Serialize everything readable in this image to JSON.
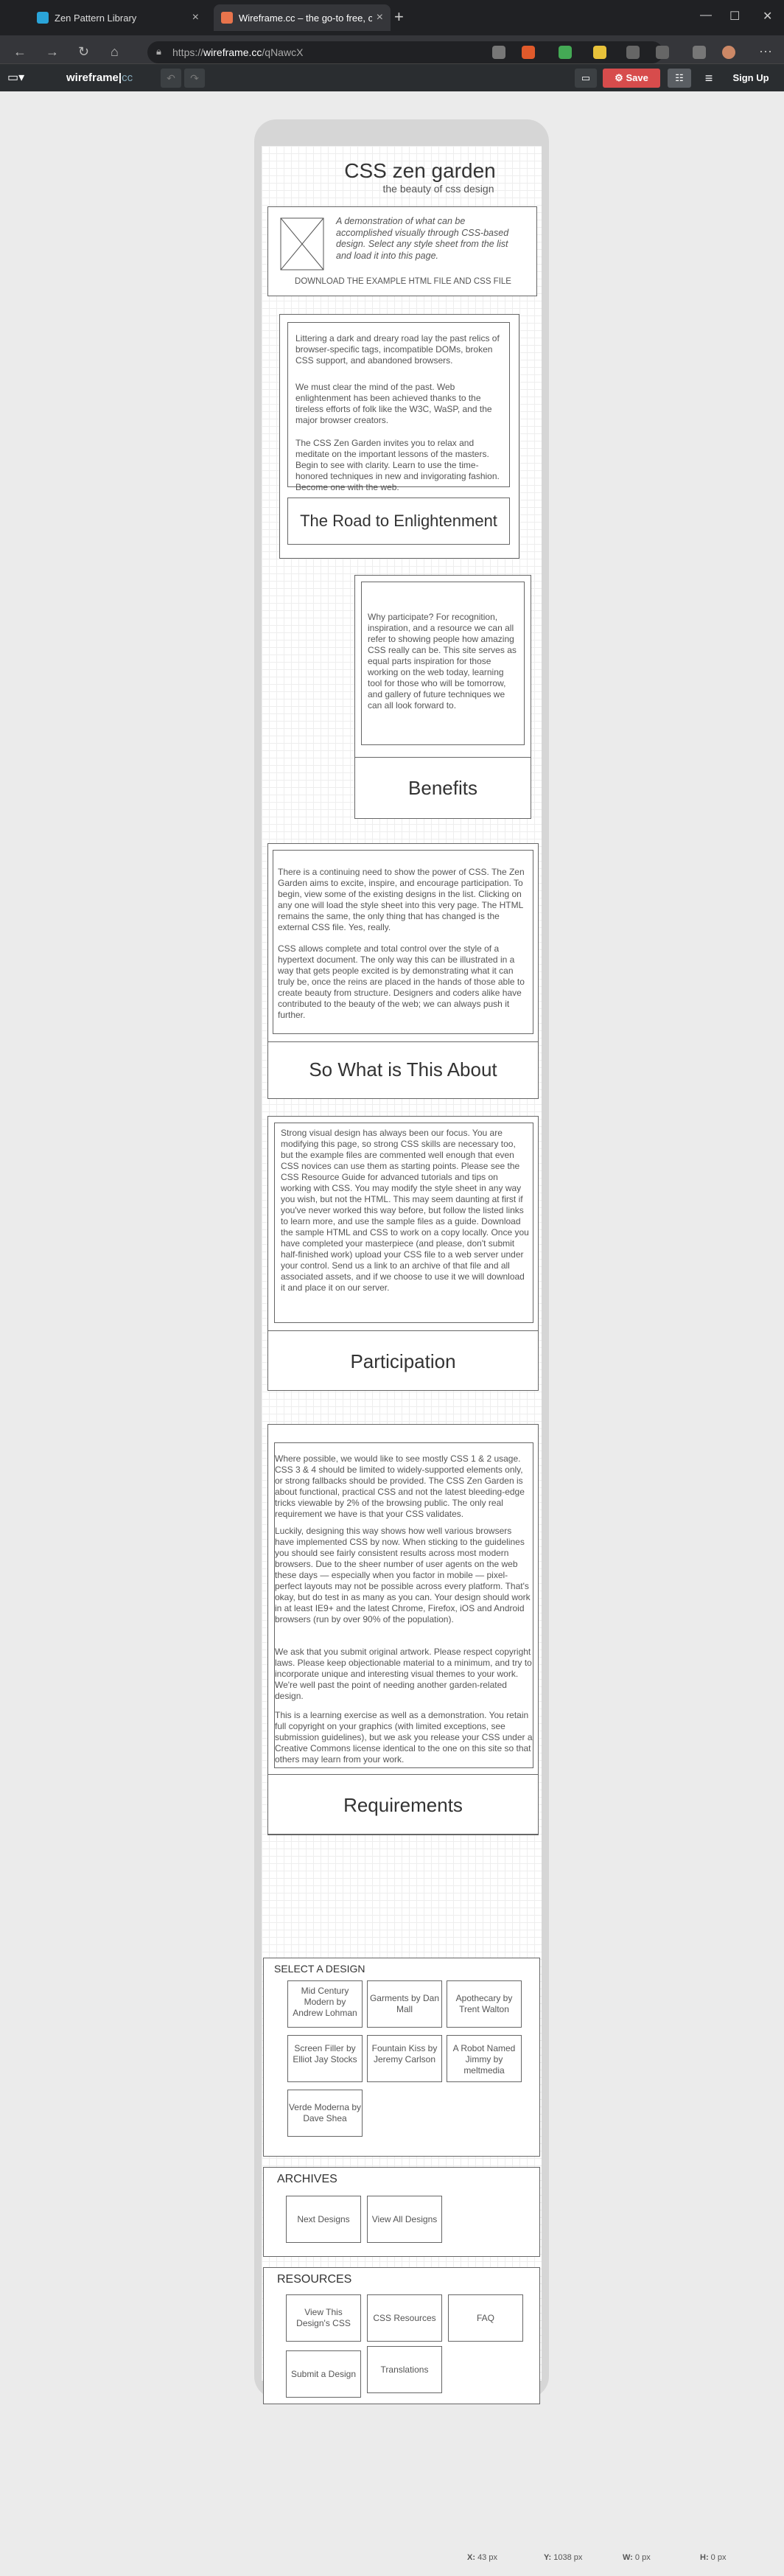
{
  "browser": {
    "tabs": [
      {
        "title": "Zen Pattern Library",
        "color": "#2aa4d9"
      },
      {
        "title": "Wireframe.cc – the go-to free, o",
        "color": "#e8744c"
      }
    ],
    "url_prefix": "https://",
    "url_host": "wireframe.cc",
    "url_path": "/qNawcX"
  },
  "app": {
    "logo_main": "wireframe",
    "logo_suffix": "cc",
    "save_label": "Save",
    "signup_label": "Sign Up"
  },
  "page": {
    "title": "CSS zen garden",
    "subtitle": "the beauty of css design",
    "intro": "A demonstration of what can be accomplished visually through CSS-based design. Select any style sheet from the list and load it into this page.",
    "download": "DOWNLOAD THE EXAMPLE HTML FILE AND CSS FILE",
    "road_text_1": "Littering a dark and dreary road lay the past relics of browser-specific tags, incompatible DOMs, broken CSS support, and abandoned browsers.",
    "road_text_2": "We must clear the mind of the past. Web enlightenment has been achieved thanks to the tireless efforts of folk like the W3C, WaSP, and the major browser creators.",
    "road_text_3": "The CSS Zen Garden invites you to relax and meditate on the important lessons of the masters. Begin to see with clarity. Learn to use the time-honored techniques in new and invigorating fashion. Become one with the web.",
    "road_heading": "The Road to Enlightenment",
    "benefits_text": "Why participate? For recognition, inspiration, and a resource we can all refer to showing people how amazing CSS really can be. This site serves as equal parts inspiration for those working on the web today, learning tool for those who will be tomorrow, and gallery of future techniques we can all look forward to.",
    "benefits_heading": "Benefits",
    "about_text_1": "There is a continuing need to show the power of CSS. The Zen Garden aims to excite, inspire, and encourage participation. To begin, view some of the existing designs in the list. Clicking on any one will load the style sheet into this very page. The HTML remains the same, the only thing that has changed is the external CSS file. Yes, really.",
    "about_text_2": "CSS allows complete and total control over the style of a hypertext document. The only way this can be illustrated in a way that gets people excited is by demonstrating what it can truly be, once the reins are placed in the hands of those able to create beauty from structure. Designers and coders alike have contributed to the beauty of the web; we can always push it further.",
    "about_heading": "So What is This About",
    "part_text": "Strong visual design has always been our focus. You are modifying this page, so strong CSS skills are necessary too, but the example files are commented well enough that even CSS novices can use them as starting points. Please see the CSS Resource Guide for advanced tutorials and tips on working with CSS. You may modify the style sheet in any way you wish, but not the HTML. This may seem daunting at first if you've never worked this way before, but follow the listed links to learn more, and use the sample files as a guide. Download the sample HTML and CSS to work on a copy locally. Once you have completed your masterpiece (and please, don't submit half-finished work) upload your CSS file to a web server under your control. Send us a link to an archive of that file and all associated assets, and if we choose to use it we will download it and place it on our server.",
    "part_heading": "Participation",
    "req_text_1": "Where possible, we would like to see mostly CSS 1 & 2 usage. CSS 3 & 4 should be limited to widely-supported elements only, or strong fallbacks should be provided. The CSS Zen Garden is about functional, practical CSS and not the latest bleeding-edge tricks viewable by 2% of the browsing public. The only real requirement we have is that your CSS validates.",
    "req_text_2": "Luckily, designing this way shows how well various browsers have implemented CSS by now. When sticking to the guidelines you should see fairly consistent results across most modern browsers. Due to the sheer number of user agents on the web these days — especially when you factor in mobile — pixel-perfect layouts may not be possible across every platform. That's okay, but do test in as many as you can. Your design should work in at least IE9+ and the latest Chrome, Firefox, iOS and Android browsers (run by over 90% of the population).",
    "req_text_3": "We ask that you submit original artwork. Please respect copyright laws. Please keep objectionable material to a minimum, and try to incorporate unique and interesting visual themes to your work. We're well past the point of needing another garden-related design.",
    "req_text_4": "This is a learning exercise as well as a demonstration. You retain full copyright on your graphics (with limited exceptions, see submission guidelines), but we ask you release your CSS under a Creative Commons license identical to the one on this site so that others may learn from your work.",
    "req_heading": "Requirements",
    "select_heading": "SELECT A DESIGN",
    "designs": [
      "Mid Century Modern by Andrew Lohman",
      "Garments by Dan Mall",
      "Apothecary by Trent Walton",
      "Screen Filler by Elliot Jay Stocks",
      "Fountain Kiss by Jeremy Carlson",
      "A Robot Named Jimmy by meltmedia",
      "Verde Moderna by Dave Shea"
    ],
    "archives_heading": "ARCHIVES",
    "archives": [
      "Next Designs",
      "View All Designs"
    ],
    "resources_heading": "RESOURCES",
    "resources": [
      "View This Design's CSS",
      "CSS Resources",
      "FAQ",
      "Submit a Design",
      "Translations"
    ]
  },
  "status": {
    "x_label": "X:",
    "x_val": "43 px",
    "y_label": "Y:",
    "y_val": "1038 px",
    "w_label": "W:",
    "w_val": "0 px",
    "h_label": "H:",
    "h_val": "0 px"
  }
}
